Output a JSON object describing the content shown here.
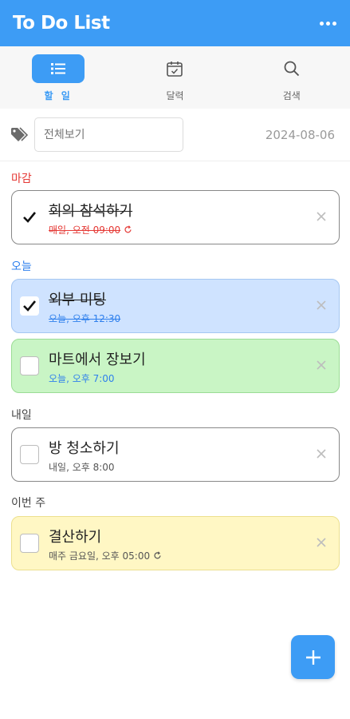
{
  "app": {
    "title": "To Do List"
  },
  "tabs": [
    {
      "label": "할 일",
      "icon": "list-icon",
      "active": true
    },
    {
      "label": "달력",
      "icon": "calendar-icon",
      "active": false
    },
    {
      "label": "검색",
      "icon": "search-icon",
      "active": false
    }
  ],
  "filter": {
    "placeholder": "전체보기",
    "value": "",
    "date": "2024-08-06"
  },
  "sections": {
    "deadline": "마감",
    "today": "오늘",
    "tomorrow": "내일",
    "this_week": "이번 주"
  },
  "tasks": [
    {
      "title": "회의 참석하기",
      "subtitle": "매일, 오전 09:00",
      "checked": true,
      "repeat": true,
      "subtitle_color": "#e53935",
      "card_color": "white"
    },
    {
      "title": "외부 미팅",
      "subtitle": "오늘, 오후 12:30",
      "checked": true,
      "repeat": false,
      "subtitle_color": "#2f80ed",
      "card_color": "blue"
    },
    {
      "title": "마트에서 장보기",
      "subtitle": "오늘, 오후 7:00",
      "checked": false,
      "repeat": false,
      "subtitle_color": "#2f80ed",
      "card_color": "green"
    },
    {
      "title": "방 청소하기",
      "subtitle": "내일, 오후 8:00",
      "checked": false,
      "repeat": false,
      "subtitle_color": "#555555",
      "card_color": "white"
    },
    {
      "title": "결산하기",
      "subtitle": "매주 금요일, 오후 05:00",
      "checked": false,
      "repeat": true,
      "subtitle_color": "#555555",
      "card_color": "yellow"
    }
  ],
  "colors": {
    "accent": "#3d9cf5",
    "deadline": "#e53935",
    "today": "#2f80ed"
  },
  "fab": {
    "icon": "plus-icon"
  }
}
